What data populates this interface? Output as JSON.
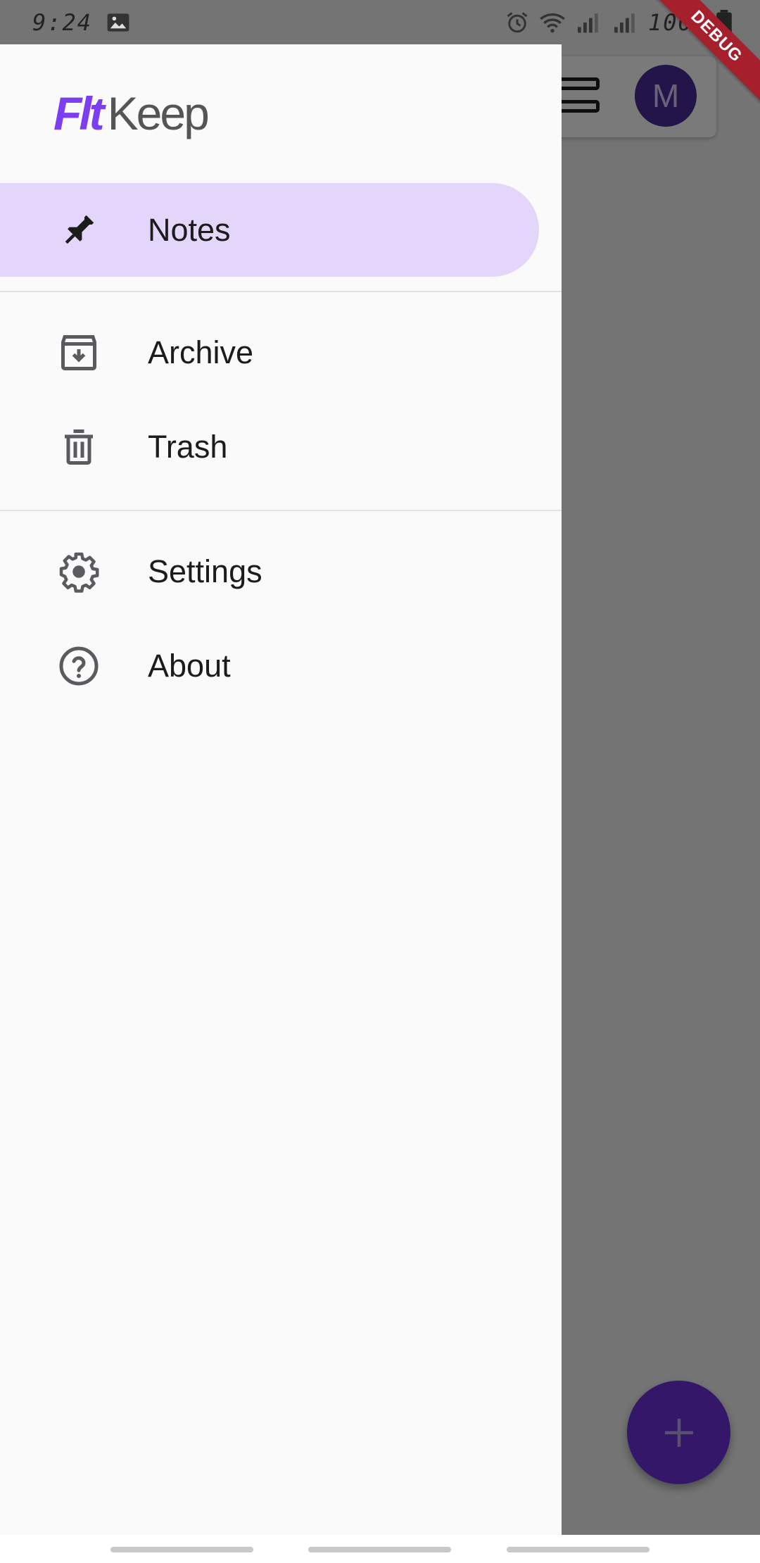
{
  "status_bar": {
    "time": "9:24",
    "battery": "100%"
  },
  "debug_banner": "DEBUG",
  "app": {
    "avatar_initial": "M"
  },
  "drawer": {
    "logo": {
      "part1": "Flt",
      "part2": "Keep"
    },
    "items": [
      {
        "label": "Notes",
        "icon": "pin-icon",
        "selected": true
      },
      {
        "label": "Archive",
        "icon": "archive-icon",
        "selected": false
      },
      {
        "label": "Trash",
        "icon": "trash-icon",
        "selected": false
      },
      {
        "label": "Settings",
        "icon": "settings-gear-icon",
        "selected": false
      },
      {
        "label": "About",
        "icon": "help-circle-icon",
        "selected": false
      }
    ]
  },
  "colors": {
    "accent": "#7c3ef0",
    "selected_bg": "#e3d6fa",
    "fab": "#6e31d9",
    "avatar": "#4a2a9c",
    "debug_ribbon": "#a5202c"
  }
}
